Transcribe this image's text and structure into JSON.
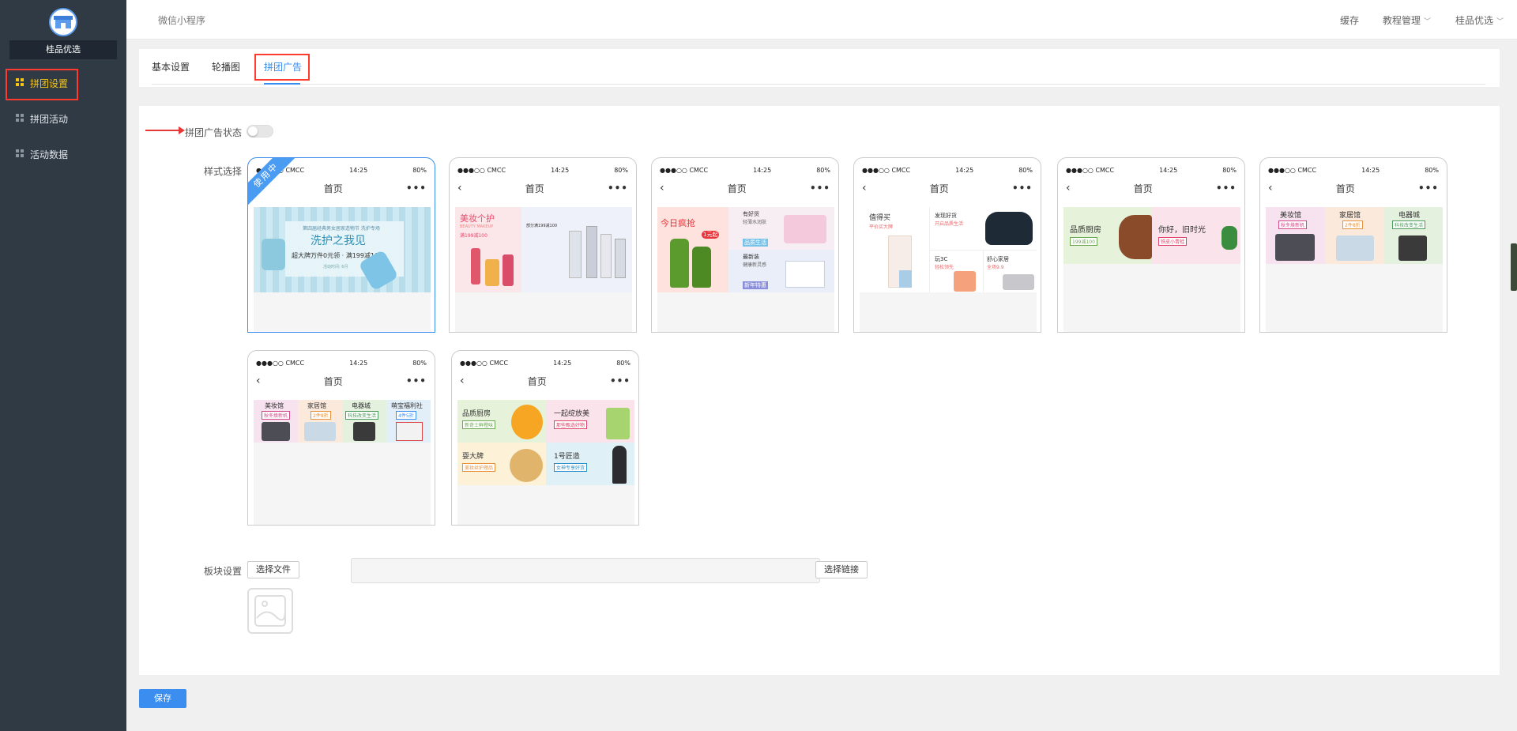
{
  "brand": {
    "name": "桂品优选"
  },
  "sidebar": {
    "items": [
      {
        "label": "拼团设置",
        "icon": "grid-icon",
        "active": true
      },
      {
        "label": "拼团活动",
        "icon": "grid-icon",
        "active": false
      },
      {
        "label": "活动数据",
        "icon": "grid-icon",
        "active": false
      }
    ]
  },
  "topbar": {
    "crumb": "微信小程序",
    "cache": "缓存",
    "tutorial": "教程管理",
    "user": "桂品优选"
  },
  "tabs": [
    {
      "label": "基本设置",
      "active": false
    },
    {
      "label": "轮播图",
      "active": false
    },
    {
      "label": "拼团广告",
      "active": true
    }
  ],
  "form": {
    "status_label": "拼团广告状态",
    "status_on": false,
    "style_label": "样式选择",
    "block_label": "板块设置",
    "choose_file": "选择文件",
    "choose_link": "选择链接",
    "save": "保存"
  },
  "phone": {
    "carrier": "●●●○○ CMCC",
    "time": "14:25",
    "battery": "80%",
    "title": "首页",
    "in_use": "使用中"
  },
  "styles": [
    {
      "id": 1,
      "selected": true,
      "texts": [
        "第四届经典男女居家造物节 洗护专场",
        "洗护之我见",
        "超大牌万件0元领 · 满199减100",
        "活动时间: 6月"
      ]
    },
    {
      "id": 2,
      "selected": false,
      "texts": [
        "美妆个护",
        "BEAUTY MAKEUP",
        "满199减100",
        "部分满199减100"
      ]
    },
    {
      "id": 3,
      "selected": false,
      "texts": [
        "今日疯抢",
        "1元起",
        "有好货",
        "轻薄水润肤",
        "品质生活",
        "最新装",
        "健康新灵感",
        "新年特惠"
      ]
    },
    {
      "id": 4,
      "selected": false,
      "texts": [
        "值得买",
        "平价买大牌",
        "发现好货",
        "开启品质生活",
        "玩3C",
        "轻松领先",
        "舒心家居",
        "全场9.9"
      ]
    },
    {
      "id": 5,
      "selected": false,
      "texts": [
        "品质厨房",
        "199减100",
        "你好，旧时光",
        "铁皮小青蛙"
      ]
    },
    {
      "id": 6,
      "selected": false,
      "texts": [
        "美妆馆",
        "秋冬焕新机",
        "家居馆",
        "2件8折",
        "电器城",
        "科技改变生活"
      ]
    },
    {
      "id": 7,
      "selected": false,
      "texts": [
        "美妆馆",
        "秋冬焕新机",
        "家居馆",
        "2件8折",
        "电器城",
        "科技改变生活",
        "萌宝福利社",
        "4件5折"
      ]
    },
    {
      "id": 8,
      "selected": false,
      "texts": [
        "品质厨房",
        "新奇士鲜橙味",
        "一起绽放美",
        "那些甄选好物",
        "耍大牌",
        "美妆丝护理品",
        "1号匠造",
        "女神专享好货"
      ]
    }
  ],
  "colors": {
    "sidebar_bg": "#2f3a45",
    "accent": "#3b8df0",
    "active_menu": "#f5c518",
    "highlight_box": "#ff3b30"
  }
}
